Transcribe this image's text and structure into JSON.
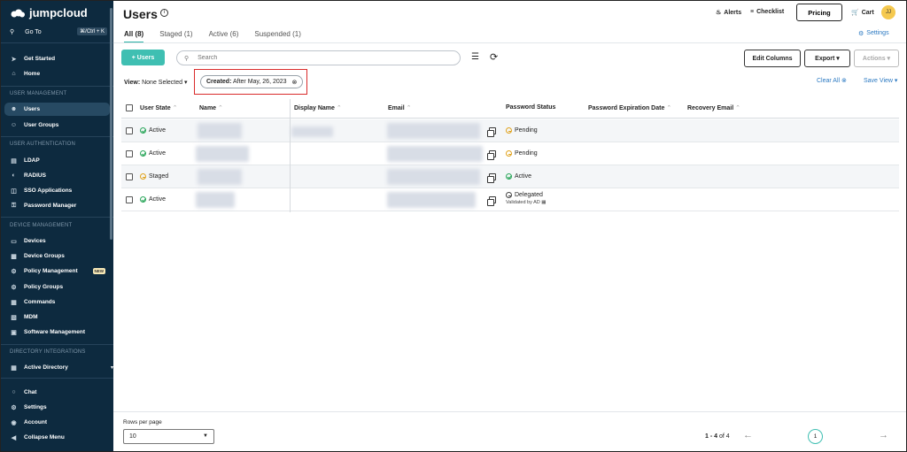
{
  "sidebar": {
    "brand": "jumpcloud",
    "goto": {
      "label": "Go To",
      "shortcut": "⌘/Ctrl + K"
    },
    "items_top": [
      {
        "label": "Get Started",
        "icon": "rocket-icon"
      },
      {
        "label": "Home",
        "icon": "home-icon"
      }
    ],
    "section_user_management": "USER MANAGEMENT",
    "user_management": [
      {
        "label": "Users",
        "icon": "user-icon",
        "active": true
      },
      {
        "label": "User Groups",
        "icon": "users-icon"
      }
    ],
    "section_user_auth": "USER AUTHENTICATION",
    "user_auth": [
      {
        "label": "LDAP",
        "icon": "ldap-icon"
      },
      {
        "label": "RADIUS",
        "icon": "radius-icon"
      },
      {
        "label": "SSO Applications",
        "icon": "sso-icon"
      },
      {
        "label": "Password Manager",
        "icon": "key-icon"
      }
    ],
    "section_device_mgmt": "DEVICE MANAGEMENT",
    "device_mgmt": [
      {
        "label": "Devices",
        "icon": "devices-icon"
      },
      {
        "label": "Device Groups",
        "icon": "device-groups-icon"
      },
      {
        "label": "Policy Management",
        "icon": "policy-icon",
        "badge": "NEW"
      },
      {
        "label": "Policy Groups",
        "icon": "policy-groups-icon"
      },
      {
        "label": "Commands",
        "icon": "terminal-icon"
      },
      {
        "label": "MDM",
        "icon": "mdm-icon"
      },
      {
        "label": "Software Management",
        "icon": "software-icon"
      }
    ],
    "section_dir_integrations": "DIRECTORY INTEGRATIONS",
    "dir_integrations": [
      {
        "label": "Active Directory",
        "icon": "active-directory-icon"
      }
    ],
    "bottom": [
      {
        "label": "Chat",
        "icon": "chat-icon"
      },
      {
        "label": "Settings",
        "icon": "gear-icon"
      },
      {
        "label": "Account",
        "icon": "account-icon"
      },
      {
        "label": "Collapse Menu",
        "icon": "collapse-icon"
      }
    ]
  },
  "header": {
    "title": "Users",
    "alerts": "Alerts",
    "checklist": "Checklist",
    "pricing": "Pricing",
    "cart": "Cart",
    "avatar_initials": "JJ"
  },
  "tabs": [
    {
      "label": "All (8)",
      "active": true
    },
    {
      "label": "Staged (1)"
    },
    {
      "label": "Active (6)"
    },
    {
      "label": "Suspended (1)"
    }
  ],
  "settings_link": "Settings",
  "toolbar": {
    "add_users": "+ Users",
    "search_placeholder": "Search",
    "edit_columns": "Edit Columns",
    "export": "Export ▾",
    "actions": "Actions ▾"
  },
  "filters": {
    "view_label": "View:",
    "view_value": "None Selected",
    "chip_key": "Created:",
    "chip_value": "After May, 26, 2023",
    "clear_all": "Clear All",
    "save_view": "Save View"
  },
  "table": {
    "columns": [
      "User State",
      "Name",
      "Display Name",
      "Email",
      "Password Status",
      "Password Expiration Date",
      "Recovery Email"
    ],
    "rows": [
      {
        "state": "Active",
        "state_kind": "ok",
        "password_status": "Pending",
        "pw_kind": "pending",
        "sub": ""
      },
      {
        "state": "Active",
        "state_kind": "ok",
        "password_status": "Pending",
        "pw_kind": "pending",
        "sub": ""
      },
      {
        "state": "Staged",
        "state_kind": "pending",
        "password_status": "Active",
        "pw_kind": "ok",
        "sub": ""
      },
      {
        "state": "Active",
        "state_kind": "ok",
        "password_status": "Delegated",
        "pw_kind": "delegated",
        "sub": "Validated by AD"
      }
    ]
  },
  "pagination": {
    "rows_per_page_label": "Rows per page",
    "rows_per_page": "10",
    "range": "1 - 4",
    "of_text": "of 4",
    "page": "1"
  },
  "colors": {
    "sidebar_bg": "#0d2a3f",
    "accent": "#3fbfb2",
    "link": "#2b79c2",
    "highlight_border": "#d92b2b"
  }
}
